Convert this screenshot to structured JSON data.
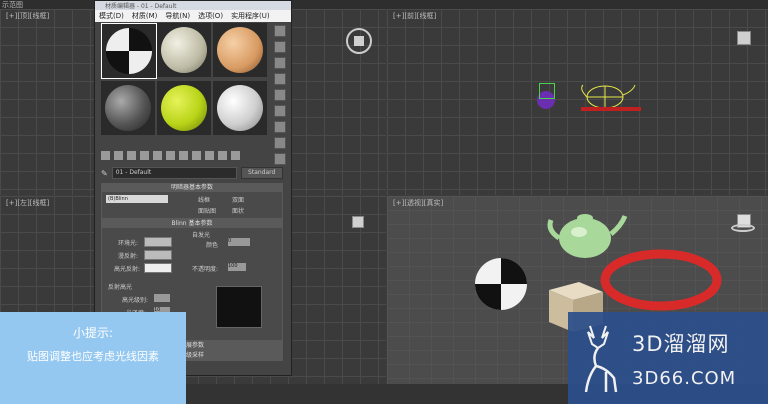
{
  "app": {
    "top_label": "示范图"
  },
  "viewports": {
    "top_left_label": "[+][顶][线框]",
    "top_right_label": "[+][前][线框]",
    "bottom_left_label": "[+][左][线框]",
    "bottom_right_label": "[+][透视][真实]"
  },
  "material_editor": {
    "title": "材质编辑器 - 01 - Default",
    "menu": [
      "模式(D)",
      "材质(M)",
      "导航(N)",
      "选项(O)",
      "实用程序(U)"
    ],
    "material_name": "01 - Default",
    "material_type": "Standard",
    "shader_section": "明暗器基本参数",
    "shader_type": "(B)Blinn",
    "shader_options": [
      "线框",
      "双面",
      "面贴图",
      "面状"
    ],
    "blinn_section": "Blinn 基本参数",
    "self_illum": "自发光",
    "color_label": "颜色",
    "color_value": "0",
    "ambient_label": "环境光:",
    "diffuse_label": "漫反射:",
    "specular_label": "高光反射:",
    "opacity_label": "不透明度:",
    "opacity_value": "100",
    "spec_highlights": "反射高光",
    "spec_level_label": "高光级别:",
    "gloss_label": "光泽度:",
    "gloss_value": "10",
    "more_1": "扩展参数",
    "more_2": "超级采样"
  },
  "hint": {
    "title": "小提示:",
    "body": "贴图调整也应考虑光线因素"
  },
  "logo": {
    "cn": "3D溜溜网",
    "en": "3D66.COM"
  },
  "colors": {
    "hint_bg": "#95c8f0",
    "logo_bg": "#2c4f8c",
    "teapot": "#a8d89a",
    "torus": "#d92a2a"
  }
}
